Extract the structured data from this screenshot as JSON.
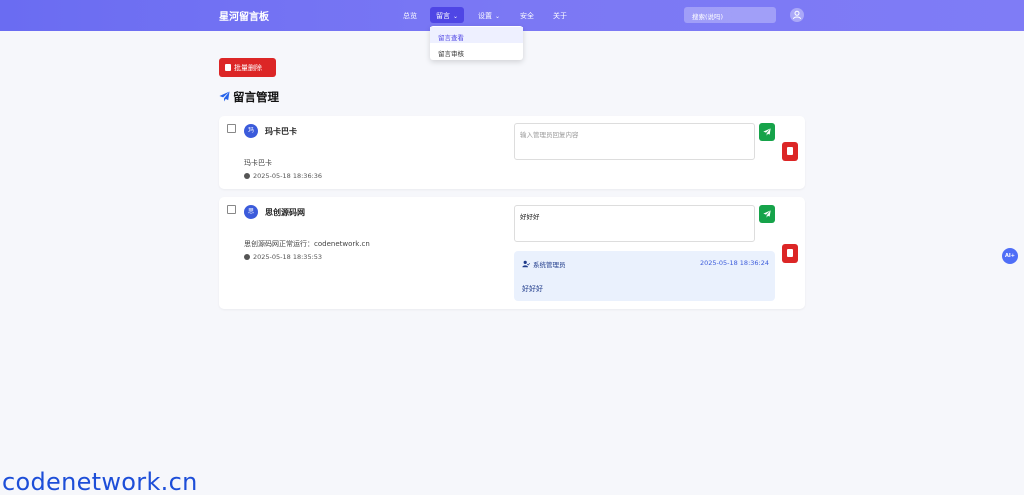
{
  "brand": "星河留言板",
  "nav": {
    "items": [
      {
        "label": "总览"
      },
      {
        "label": "留言"
      },
      {
        "label": "设置"
      },
      {
        "label": "安全"
      },
      {
        "label": "关于"
      }
    ],
    "search_placeholder": "搜索(说吗)"
  },
  "dropdown": {
    "items": [
      {
        "label": "留言查看"
      },
      {
        "label": "留言审核"
      }
    ]
  },
  "bulk_delete_label": "批量删除",
  "section_title": "留言管理",
  "messages": [
    {
      "avatar_char": "玛",
      "author": "玛卡巴卡",
      "content": "玛卡巴卡",
      "time": "2025-05-18 18:36:36",
      "reply_placeholder": "输入管理员回复内容",
      "reply_value": ""
    },
    {
      "avatar_char": "思",
      "author": "思创源码网",
      "content": "思创源码网正常运行：codenetwork.cn",
      "time": "2025-05-18 18:35:53",
      "reply_value": "好好好",
      "admin_reply": {
        "name": "系统管理员",
        "time": "2025-05-18 18:36:24",
        "text": "好好好"
      }
    }
  ],
  "ai_button_label": "AI+",
  "watermark": "codenetwork.cn",
  "colors": {
    "navbar": "#6a6cf2",
    "accent": "#4f46e5",
    "danger": "#dc2626",
    "success": "#16a34a"
  }
}
